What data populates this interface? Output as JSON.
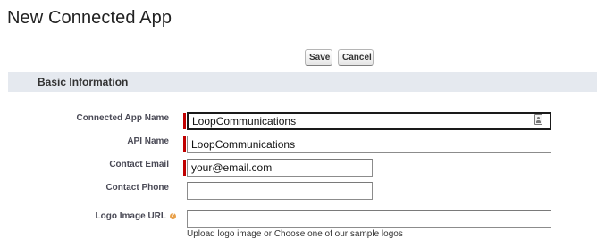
{
  "page": {
    "title": "New Connected App"
  },
  "toolbar": {
    "save_label": "Save",
    "cancel_label": "Cancel"
  },
  "section": {
    "title": "Basic Information"
  },
  "fields": {
    "connected_app_name": {
      "label": "Connected App Name",
      "value": "LoopCommunications",
      "required": true
    },
    "api_name": {
      "label": "API Name",
      "value": "LoopCommunications",
      "required": true
    },
    "contact_email": {
      "label": "Contact Email",
      "value": "your@email.com",
      "required": true
    },
    "contact_phone": {
      "label": "Contact Phone",
      "value": "",
      "required": false
    },
    "logo_image_url": {
      "label": "Logo Image URL",
      "value": "",
      "required": false,
      "hint": "Upload logo image or Choose one of our sample logos"
    }
  },
  "icons": {
    "contact_card": "contact-card-icon",
    "help": "help-icon"
  },
  "colors": {
    "required_marker": "#c00000",
    "section_header_bg": "#e5e9ef"
  }
}
